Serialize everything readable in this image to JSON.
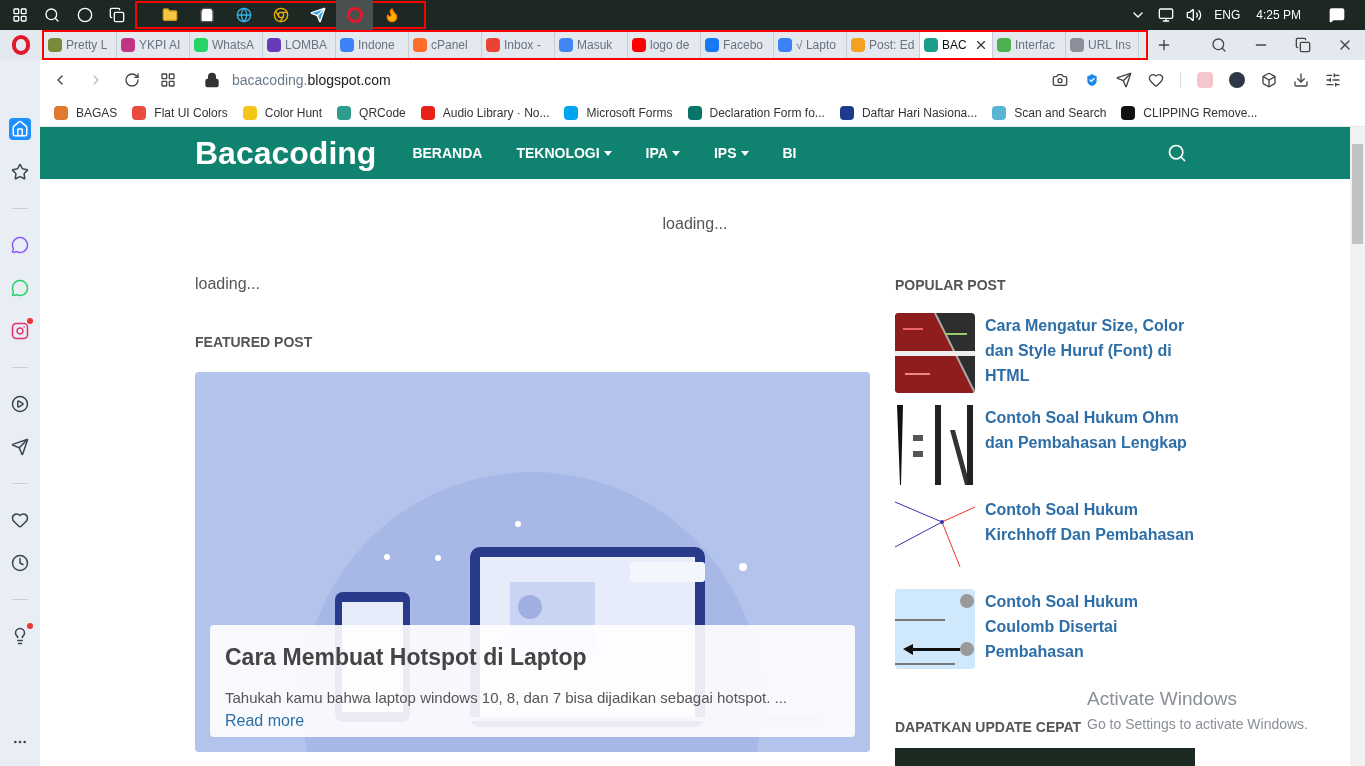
{
  "taskbar": {
    "apps": [
      {
        "kind": "folder",
        "selected": false
      },
      {
        "kind": "store",
        "selected": false
      },
      {
        "kind": "edge",
        "selected": false
      },
      {
        "kind": "chrome",
        "selected": false
      },
      {
        "kind": "telegram",
        "selected": false
      },
      {
        "kind": "opera",
        "selected": true
      },
      {
        "kind": "firefox",
        "selected": false
      }
    ],
    "language": "ENG",
    "time": "4:25 PM"
  },
  "tabs": [
    {
      "title": "Pretty L",
      "color": "#7a8a3a",
      "selected": false
    },
    {
      "title": "YKPI AI",
      "color": "#c13584",
      "selected": false
    },
    {
      "title": "WhatsA",
      "color": "#25d366",
      "selected": false
    },
    {
      "title": "LOMBA",
      "color": "#673ab7",
      "selected": false
    },
    {
      "title": "Indone",
      "color": "#3b82f6",
      "selected": false
    },
    {
      "title": "cPanel",
      "color": "#ff6c2c",
      "selected": false
    },
    {
      "title": "Inbox -",
      "color": "#ea4335",
      "selected": false
    },
    {
      "title": "Masuk",
      "color": "#4285f4",
      "selected": false
    },
    {
      "title": "logo de",
      "color": "#ff0000",
      "selected": false
    },
    {
      "title": "Facebo",
      "color": "#1877f2",
      "selected": false
    },
    {
      "title": "√ Lapto",
      "color": "#3b82f6",
      "selected": false
    },
    {
      "title": "Post: Ed",
      "color": "#f4a020",
      "selected": false
    },
    {
      "title": "BAC",
      "color": "#1a9e8a",
      "selected": true
    },
    {
      "title": "Interfac",
      "color": "#4caf50",
      "selected": false
    },
    {
      "title": "URL Ins",
      "color": "#8a8f99",
      "selected": false
    }
  ],
  "address": {
    "domain_prefix": "bacacoding.",
    "domain": "blogspot.com"
  },
  "bookmarks": [
    {
      "title": "BAGAS",
      "color": "#e07a2e"
    },
    {
      "title": "Flat UI Colors",
      "color": "#e74c3c"
    },
    {
      "title": "Color Hunt",
      "color": "#f5c518"
    },
    {
      "title": "QRCode",
      "color": "#2e9d8e"
    },
    {
      "title": "Audio Library · No...",
      "color": "#e62117"
    },
    {
      "title": "Microsoft Forms",
      "color": "#00a4ef"
    },
    {
      "title": "Declaration Form fo...",
      "color": "#077568"
    },
    {
      "title": "Daftar Hari Nasiona...",
      "color": "#1e3a8a"
    },
    {
      "title": "Scan and Search",
      "color": "#5ab4d6"
    },
    {
      "title": "CLIPPING Remove...",
      "color": "#111111"
    }
  ],
  "sidebar": {
    "items": [
      {
        "kind": "home",
        "selected": true,
        "badge": false
      },
      {
        "kind": "star",
        "selected": false,
        "badge": false
      },
      {
        "kind": "divider"
      },
      {
        "kind": "messenger",
        "selected": false,
        "badge": false
      },
      {
        "kind": "whatsapp",
        "selected": false,
        "badge": false
      },
      {
        "kind": "instagram",
        "selected": false,
        "badge": true
      },
      {
        "kind": "divider"
      },
      {
        "kind": "player",
        "selected": false,
        "badge": false
      },
      {
        "kind": "send",
        "selected": false,
        "badge": false
      },
      {
        "kind": "divider"
      },
      {
        "kind": "heart",
        "selected": false,
        "badge": false
      },
      {
        "kind": "history",
        "selected": false,
        "badge": false
      },
      {
        "kind": "divider"
      },
      {
        "kind": "bulb",
        "selected": false,
        "badge": true
      }
    ]
  },
  "site": {
    "logo": "Bacacoding",
    "nav": [
      {
        "label": "BERANDA",
        "dropdown": false
      },
      {
        "label": "TEKNOLOGI",
        "dropdown": true
      },
      {
        "label": "IPA",
        "dropdown": true
      },
      {
        "label": "IPS",
        "dropdown": true
      },
      {
        "label": "BI",
        "dropdown": false
      }
    ],
    "top_loading": "loading...",
    "main_loading": "loading...",
    "featured_heading": "FEATURED POST",
    "featured": {
      "title": "Cara Membuat Hotspot di Laptop",
      "excerpt": "Tahukah kamu bahwa laptop windows 10, 8, dan 7 bisa dijadikan sebagai hotspot. ...",
      "read_more": "Read more"
    },
    "popular_heading": "POPULAR POST",
    "popular": [
      {
        "title": "Cara Mengatur Size, Color dan Style Huruf (Font) di HTML",
        "kind": "picture"
      },
      {
        "title": "Contoh Soal Hukum Ohm dan Pembahasan Lengkap",
        "kind": "picture"
      },
      {
        "title": "Contoh Soal Hukum Kirchhoff Dan Pembahasan",
        "kind": "picture"
      },
      {
        "title": "Contoh Soal Hukum Coulomb Disertai Pembahasan",
        "kind": "picture"
      }
    ],
    "update_heading": "DAPATKAN UPDATE CEPAT"
  },
  "activation": {
    "title": "Activate Windows",
    "subtitle": "Go to Settings to activate Windows."
  }
}
